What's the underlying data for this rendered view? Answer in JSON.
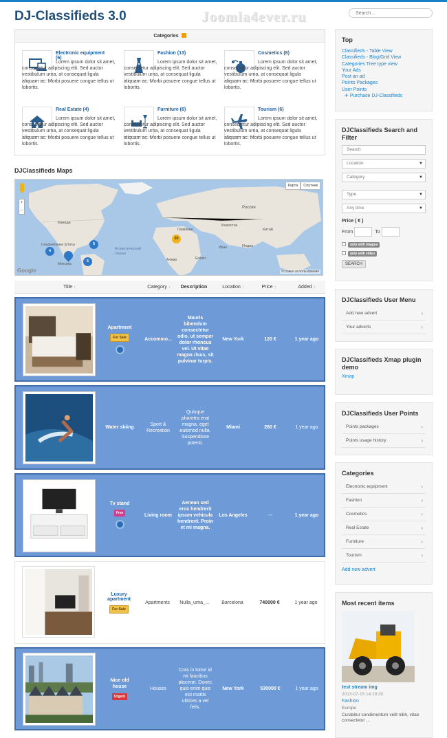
{
  "header": {
    "site_title": "DJ-Classifieds 3.0",
    "watermark": "Joomla4ever.ru",
    "search_placeholder": "Search..."
  },
  "categories_box": {
    "title": "Categories",
    "items": [
      {
        "name": "Electronic equipment (6)",
        "icon": "monitor-laptop-icon",
        "desc": "Lorem ipsum dolor sit amet, consectetur adipiscing elit. Sed auctor vestibulum urna, at consequat ligula aliquam ac. Morbi posuere congue tellus ut lobortis."
      },
      {
        "name": "Fashion (13)",
        "icon": "dress-icon",
        "desc": "Lorem ipsum dolor sit amet, consectetur adipiscing elit. Sed auctor vestibulum urna, at consequat ligula aliquam ac. Morbi posuere congue tellus ut lobortis."
      },
      {
        "name": "Cosmetics (8)",
        "icon": "perfume-icon",
        "desc": "Lorem ipsum dolor sit amet, consectetur adipiscing elit. Sed auctor vestibulum urna, at consequat ligula aliquam ac. Morbi posuere congue tellus ut lobortis."
      },
      {
        "name": "Real Estate (4)",
        "icon": "house-icon",
        "desc": "Lorem ipsum dolor sit amet, consectetur adipiscing elit. Sed auctor vestibulum urna, at consequat ligula aliquam ac. Morbi posuere congue tellus ut lobortis."
      },
      {
        "name": "Furniture (6)",
        "icon": "sofa-lamp-icon",
        "desc": "Lorem ipsum dolor sit amet, consectetur adipiscing elit. Sed auctor vestibulum urna, at consequat ligula aliquam ac. Morbi posuere congue tellus ut lobortis."
      },
      {
        "name": "Tourism (6)",
        "icon": "airplane-icon",
        "desc": "Lorem ipsum dolor sit amet, consectetur adipiscing elit. Sed auctor vestibulum urna, at consequat ligula aliquam ac. Morbi posuere congue tellus ut lobortis."
      }
    ]
  },
  "maps": {
    "title": "DJClassifieds Maps",
    "btn_map": "Карта",
    "btn_sat": "Спутник",
    "google": "Google",
    "terms": "Условия использования",
    "labels": [
      "Канада",
      "Соединённые Штаты",
      "Мексика",
      "Атлантический Океан",
      "Россия",
      "Китай",
      "Индия",
      "Германия",
      "Алжир",
      "Египет",
      "Иран",
      "Казахстан"
    ],
    "markers": [
      "5",
      "4",
      "5",
      "20"
    ]
  },
  "table": {
    "headers": [
      "Title",
      "Category",
      "Description",
      "Location",
      "Price",
      "Added"
    ],
    "rows": [
      {
        "title": "Apartment",
        "badge": "For Sale",
        "category": "Accommo...",
        "description": "Mauris bibendum consectetur odio, ut semper dolor rhoncus vel. Ut vitae magna risus, sit pulvinar turpis.",
        "location": "New York",
        "price": "120 €",
        "added": "1 year ago"
      },
      {
        "title": "Water skiing",
        "badge": "",
        "category": "Sport & Recreation",
        "description": "Quisque pharetra erat magna, eget euismod nulla. Suspendisse potenti.",
        "location": "Miami",
        "price": "260 €",
        "added": "1 year ago"
      },
      {
        "title": "Tv stand",
        "badge": "Free",
        "category": "Living room",
        "description": "Aenean sed eros hendrerit ipsum vehicula hendrerit. Proin et mi magna.",
        "location": "Los Angeles",
        "price": "---",
        "added": "1 year ago"
      },
      {
        "title": "Luxury apartment",
        "badge": "For Sale",
        "category": "Apartments",
        "description": "Nulla_urna_...",
        "location": "Barcelona",
        "price": "740000 €",
        "added": "1 year ago"
      },
      {
        "title": "Nice old house",
        "badge": "Urgent",
        "category": "Houses",
        "description": "Cras in tortor id mi faucibus placerat. Donec quis enim quis nisi mattis ultrices a vel felis.",
        "location": "New York",
        "price": "530000 €",
        "added": "1 year ago"
      }
    ]
  },
  "sidebar": {
    "top": {
      "title": "Top",
      "links": [
        "Classifieds - Table View",
        "Classifieds - Blog/Grid View",
        "Categories Tree type view",
        "Your Ads",
        "Post an ad",
        "Points Packages",
        "User Points",
        "Purchase DJ-Classifieds"
      ]
    },
    "search": {
      "title": "DJClassifieds Search and Filter",
      "search_placeholder": "Search",
      "location": "Location",
      "category": "Category",
      "type": "Type",
      "time": "Any time",
      "price_label": "Price ( € )",
      "from": "From",
      "to": "To",
      "only_images": "only with images",
      "only_video": "only with video",
      "button": "SEARCH"
    },
    "user_menu": {
      "title": "DJClassifieds User Menu",
      "items": [
        "Add new advert",
        "Your adverts"
      ]
    },
    "xmap": {
      "title": "DJClassifieds Xmap plugin demo",
      "link": "Xmap"
    },
    "points": {
      "title": "DJClassifieds User Points",
      "items": [
        "Points packages",
        "Points usage history"
      ]
    },
    "categories": {
      "title": "Categories",
      "items": [
        "Electronic equipment",
        "Fashion",
        "Cosmetics",
        "Real Estate",
        "Furniture",
        "Tourism"
      ],
      "add": "Add new advert"
    },
    "recent": {
      "title": "Most recent items",
      "item_title": "test stream img",
      "date": "2013-07-15 14:18:30",
      "category": "Fashion",
      "region": "Europe",
      "desc": "Curabitur condimentum velit nibh, vitae consectetur ..."
    }
  },
  "colors": {
    "accent": "#1f7fc4",
    "promo_bg": "#6e9bd7",
    "title": "#1f4e79"
  }
}
